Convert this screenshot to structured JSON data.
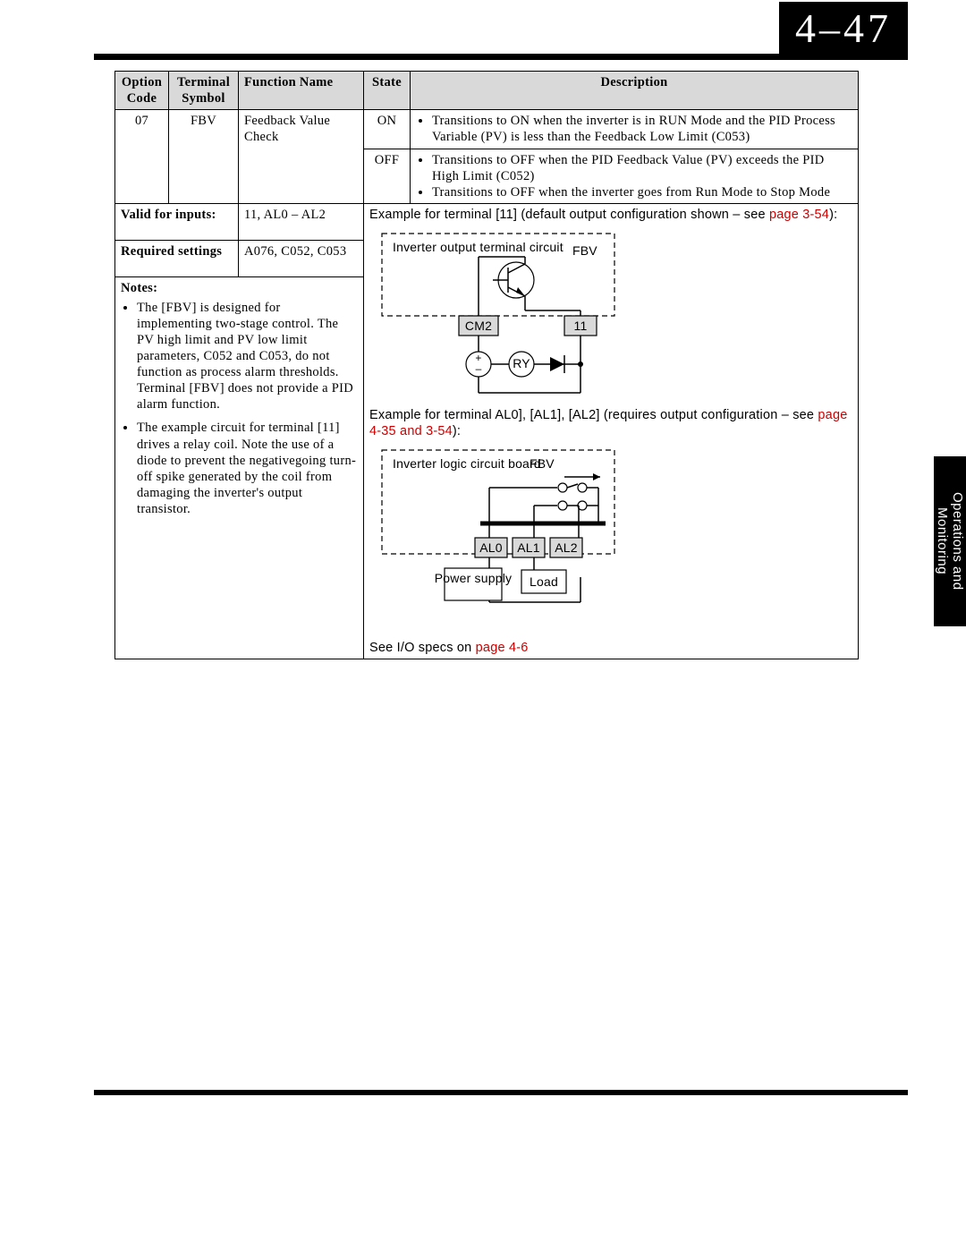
{
  "page_number": "4–47",
  "side_tab": "Operations and\nMonitoring",
  "table": {
    "headers": [
      "Option Code",
      "Terminal Symbol",
      "Function Name",
      "State",
      "Description"
    ],
    "option_code": "07",
    "terminal_symbol": "FBV",
    "function_name": "Feedback Value Check",
    "rows": [
      {
        "state": "ON",
        "bullets": [
          "Transitions to ON when the inverter is in RUN Mode and the PID Process Variable (PV) is less than the Feedback Low Limit (C053)"
        ]
      },
      {
        "state": "OFF",
        "bullets": [
          "Transitions to OFF when the PID Feedback Value (PV) exceeds the PID High Limit (C052)",
          "Transitions to OFF when the inverter goes from Run Mode to Stop Mode"
        ]
      }
    ],
    "valid_for_inputs_label": "Valid for inputs:",
    "valid_for_inputs_value": "11, AL0 – AL2",
    "required_settings_label": "Required settings",
    "required_settings_value": "A076, C052, C053",
    "notes_label": "Notes:",
    "notes": [
      "The [FBV] is designed for implementing two-stage control. The PV high limit and PV low limit parameters, C052 and C053, do not function as process alarm thresholds. Terminal [FBV] does not provide a PID alarm function.",
      "The example circuit for terminal [11] drives a relay coil. Note the use of a diode to prevent the negativegoing turn-off spike generated by the coil from damaging the inverter's output transistor."
    ],
    "example1_text": "Example for terminal [11] (default output configuration shown – see ",
    "example1_link": "page 3-54",
    "example1_suffix": "):",
    "diagram1": {
      "label_circuit": "Inverter output terminal circuit",
      "fbv": "FBV",
      "cm2": "CM2",
      "t11": "11",
      "ry": "RY"
    },
    "example2_text": "Example for terminal AL0], [AL1], [AL2] (requires output configuration – see ",
    "example2_link": "page 4-35 and 3-54",
    "example2_suffix": "):",
    "diagram2": {
      "label_board": "Inverter logic circuit board",
      "fbv": "FBV",
      "al0": "AL0",
      "al1": "AL1",
      "al2": "AL2",
      "power_supply": "Power supply",
      "load": "Load"
    },
    "io_specs_text": "See I/O specs on ",
    "io_specs_link": "page 4-6"
  }
}
